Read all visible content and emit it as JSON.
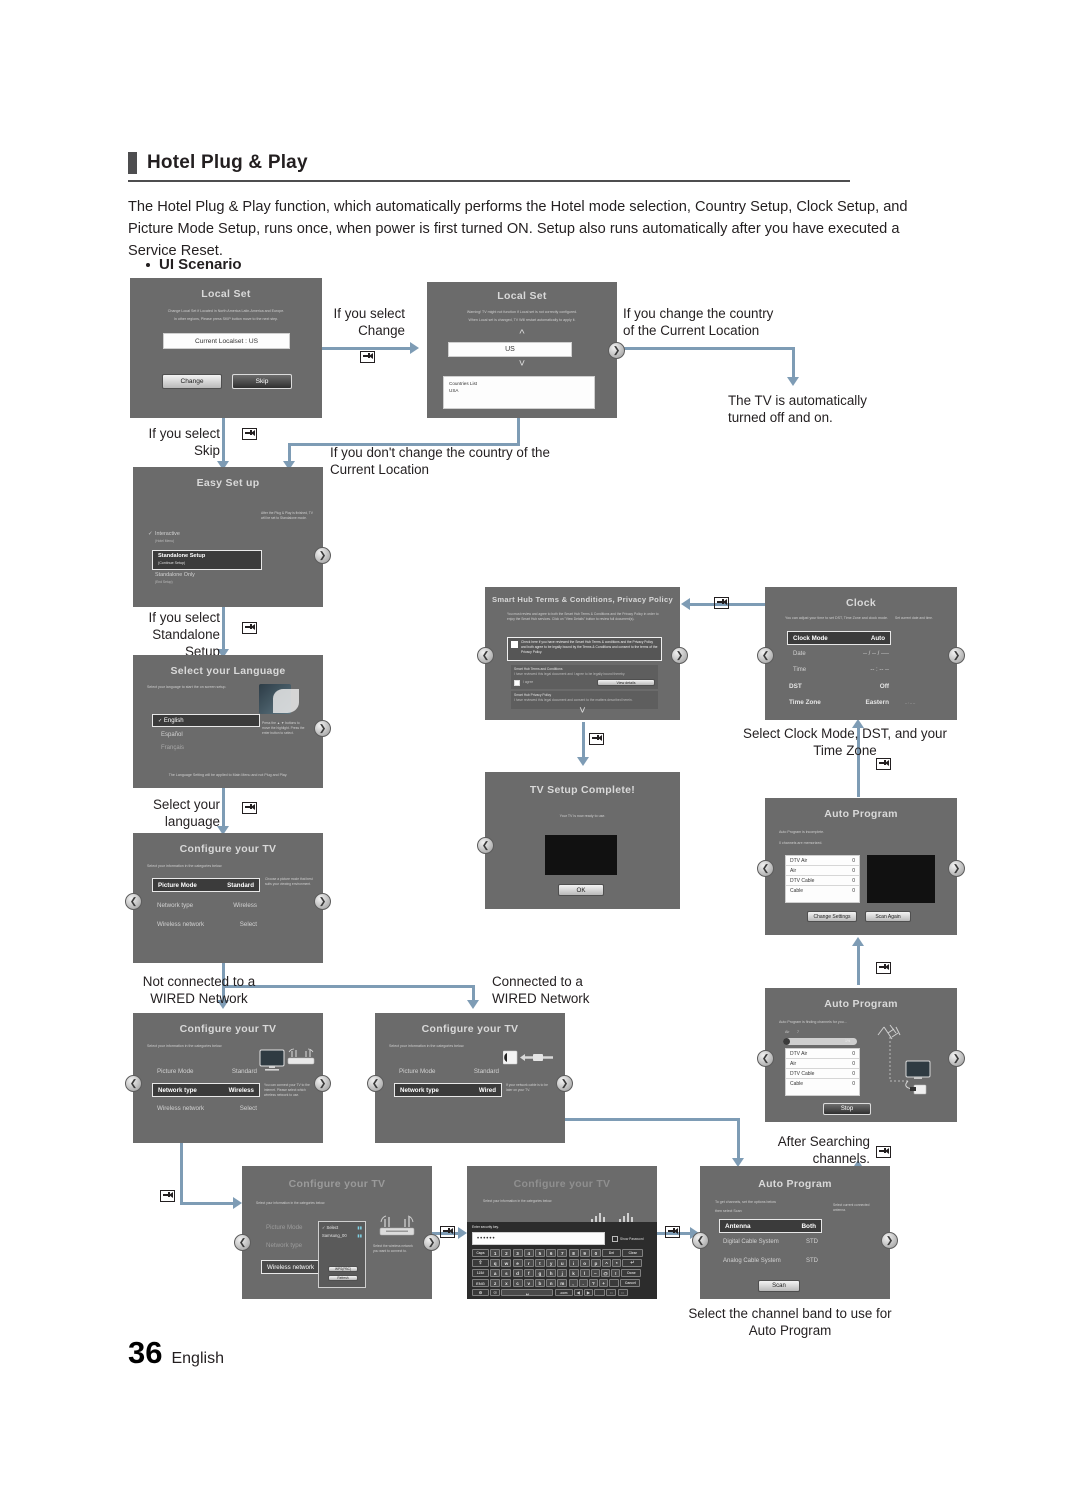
{
  "header": {
    "title": "Hotel Plug & Play",
    "intro": "The Hotel Plug & Play function, which automatically performs the Hotel mode selection, Country Setup, Clock Setup, and Picture Mode Setup, runs once, when power is first turned ON. Setup also runs automatically after you have executed a Service Reset.",
    "bullet": "UI Scenario"
  },
  "footer": {
    "page": "36",
    "language": "English"
  },
  "notes": {
    "if_select_change": "If you select\nChange",
    "if_change_country": "If you change the country\nof the Current Location",
    "tv_off_on": "The TV is automatically\nturned off and on.",
    "if_select_skip": "If you select\nSkip",
    "if_dont_change_country": "If you don't change the country of the\nCurrent Location",
    "if_select_standalone": "If you select\nStandalone\nSetup",
    "select_your_language": "Select your\nlanguage",
    "select_clock": "Select Clock Mode, DST, and your\nTime Zone",
    "not_connected_wired": "Not connected to a\nWIRED Network",
    "connected_wired": "Connected to a\nWIRED Network",
    "after_searching": "After Searching\nchannels.",
    "select_channel_band": "Select the channel band to use for\nAuto Program"
  },
  "screens": {
    "local_set_1": {
      "title": "Local Set",
      "desc1": "Change Local Set if Located in North America Latin-America and Europe.",
      "desc2": "In other regions, Please press SKIP button move to the next step.",
      "current": "Current Localset : US",
      "btn_change": "Change",
      "btn_skip": "Skip"
    },
    "local_set_2": {
      "title": "Local Set",
      "desc1": "Warning! TV might not function if Local set is not correctly configured.",
      "desc2": "When Local set is changed, TV Will restart automatically to apply it.",
      "value": "US",
      "list_title": "Countries List",
      "list_item": "USA"
    },
    "easy_setup": {
      "title": "Easy Set up",
      "hint": "After the Plug & Play is finished, TV will be set to Standalone mode.",
      "opt1": "Interactive",
      "opt1_sub": "(Hotel Menu)",
      "opt2": "Standalone Setup",
      "opt2_sub": "(Continue Setup)",
      "opt3": "Standalone Only",
      "opt3_sub": "(End Setup)"
    },
    "select_language": {
      "title": "Select your Language",
      "desc": "Select your language to start the on screen setup.",
      "opt1": "English",
      "opt2": "Español",
      "opt3": "Français",
      "hint": "Press the ▲ ▼ buttons to move the highlight. Press the enter button to select.",
      "bottom": "The Language Setting will be applied to Main Menu and not Plug and Play."
    },
    "configure_tv_main": {
      "title": "Configure your TV",
      "desc": "Select your information in the categories below.",
      "r1k": "Picture Mode",
      "r1v": "Standard",
      "r2k": "Network type",
      "r2v": "Wireless",
      "r3k": "Wireless network",
      "r3v": "Select",
      "hint": "Choose a picture mode that best suits your viewing environment."
    },
    "configure_tv_wireless": {
      "title": "Configure your TV",
      "desc": "Select your information in the categories below.",
      "r1k": "Picture Mode",
      "r1v": "Standard",
      "r2k": "Network type",
      "r2v": "Wireless",
      "r3k": "Wireless network",
      "r3v": "Select",
      "hint": "You can connect your TV to the internet. Please select which wireless network to use."
    },
    "configure_tv_wired": {
      "title": "Configure your TV",
      "desc": "Select your information in the categories below.",
      "r1k": "Picture Mode",
      "r1v": "Standard",
      "r2k": "Network type",
      "r2v": "Wired",
      "hint": "If your network cable is to be later on your TV."
    },
    "configure_tv_aplist": {
      "title": "Configure your TV",
      "desc": "Select your information in the categories below.",
      "r1k": "Picture Mode",
      "r2k": "Network type",
      "r3k": "Wireless network",
      "ap1": "Select",
      "ap2": "Samsung_00",
      "btn1": "Refresh",
      "btn2": "WPS(PBC)",
      "hint": "Select the wireless network you want to connect to."
    },
    "configure_tv_keyboard": {
      "title": "Configure your TV",
      "desc": "Select your information in the categories below.",
      "key_label": "Enter security key.",
      "password": "••••••",
      "show_password": "Show Password",
      "keys_row1": [
        "1",
        "2",
        "3",
        "4",
        "5",
        "6",
        "7",
        "8",
        "9",
        "0"
      ],
      "keys_row2": [
        "q",
        "w",
        "e",
        "r",
        "t",
        "y",
        "u",
        "i",
        "o",
        "p",
        "^",
        "*"
      ],
      "keys_row3": [
        "a",
        "s",
        "d",
        "f",
        "g",
        "h",
        "j",
        "k",
        "l",
        "~",
        "@",
        "!"
      ],
      "keys_row4": [
        "z",
        "x",
        "c",
        "v",
        "b",
        "n",
        "m",
        ",",
        ".",
        "?",
        "+"
      ],
      "k_caps": "Caps",
      "k_shift": "⇧",
      "k_sym": "123#",
      "k_del": "Del",
      "k_clear": "Clear",
      "k_enter": "↵",
      "k_done": "Done",
      "k_cancel": "Cancel"
    },
    "smart_hub": {
      "title": "Smart Hub Terms & Conditions, Privacy Policy",
      "desc": "You must review and agree to both the Smart Hub Terms & Conditions and the Privacy Policy in order to enjoy the Smart Hub services. Click on \"View Details\" button to review full document(s).",
      "check_text": "Check here if you have reviewed the Smart Hub Terms & conditions and the Privacy Policy and both agree to be legally bound by the Terms & Conditions and consent to the terms of the Privacy Policy.",
      "sec1_title": "Smart Hub Terms and Conditions",
      "sec1_desc": "I have reviewed this legal document and I agree to be legally bound thereby.",
      "agree": "I agree",
      "view_details": "View details",
      "sec2_title": "Smart Hub Privacy Policy",
      "sec2_desc": "I have reviewed this legal document and consent to the matters described herein."
    },
    "tv_setup_complete": {
      "title": "TV Setup Complete!",
      "desc": "Your TV is now ready to use.",
      "btn_ok": "OK"
    },
    "clock": {
      "title": "Clock",
      "desc": "You can adjust your time to set DST, Time Zone and clock mode.",
      "hint": "Set current date and time.",
      "r1k": "Clock Mode",
      "r1v": "Auto",
      "r2k": "Date",
      "r2v": "-- / -- / ----",
      "r3k": "Time",
      "r3v": "-- : -- --",
      "r4k": "DST",
      "r4v": "Off",
      "r5k": "Time Zone",
      "r5v": "Eastern",
      "r5extra": "-- : -- --"
    },
    "auto_program_result": {
      "title": "Auto Program",
      "desc1": "Auto Program is incomplete.",
      "desc2": "0 channels are memorized.",
      "rows": [
        {
          "k": "DTV Air",
          "v": "0"
        },
        {
          "k": "Air",
          "v": "0"
        },
        {
          "k": "DTV Cable",
          "v": "0"
        },
        {
          "k": "Cable",
          "v": "0"
        }
      ],
      "btn1": "Change Settings",
      "btn2": "Scan Again"
    },
    "auto_program_scanning": {
      "title": "Auto Program",
      "desc1": "Auto Program is finding channels for you...",
      "band": "Air",
      "channel": "7",
      "percent": "1%",
      "rows": [
        {
          "k": "DTV Air",
          "v": "0"
        },
        {
          "k": "Air",
          "v": "0"
        },
        {
          "k": "DTV Cable",
          "v": "0"
        },
        {
          "k": "Cable",
          "v": "0"
        }
      ],
      "btn_stop": "Stop"
    },
    "auto_program_settings": {
      "title": "Auto Program",
      "desc1": "To get channels, set the options below",
      "desc2": "then select Scan",
      "hint": "Select current connected antenna.",
      "r1k": "Antenna",
      "r1v": "Both",
      "r2k": "Digital Cable System",
      "r2v": "STD",
      "r3k": "Analog Cable System",
      "r3v": "STD",
      "btn_scan": "Scan"
    }
  }
}
